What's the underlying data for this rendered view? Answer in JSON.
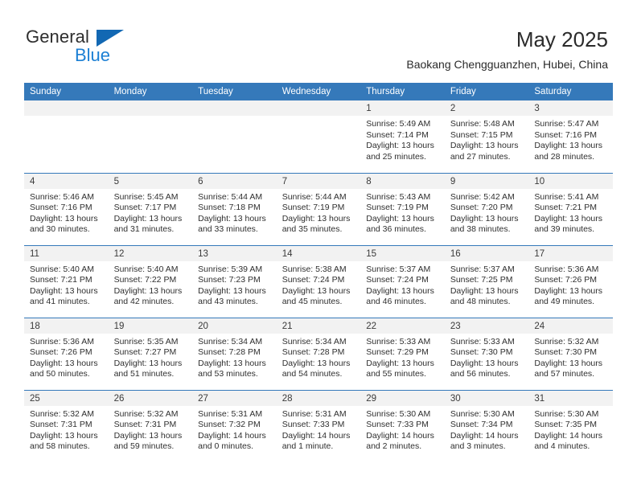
{
  "brand": {
    "name_part1": "General",
    "name_part2": "Blue",
    "triangle_color": "#1268b3",
    "blue_color": "#1b7fd4"
  },
  "header": {
    "title": "May 2025",
    "subtitle": "Baokang Chengguanzhen, Hubei, China"
  },
  "theme": {
    "header_bg": "#3579ba",
    "daynum_band_bg": "#f2f2f2",
    "grid_line": "#3579ba"
  },
  "weekday_headers": [
    "Sunday",
    "Monday",
    "Tuesday",
    "Wednesday",
    "Thursday",
    "Friday",
    "Saturday"
  ],
  "weeks": [
    [
      {
        "day": "",
        "empty": true,
        "sunrise": "",
        "sunset": "",
        "daylight1": "",
        "daylight2": ""
      },
      {
        "day": "",
        "empty": true,
        "sunrise": "",
        "sunset": "",
        "daylight1": "",
        "daylight2": ""
      },
      {
        "day": "",
        "empty": true,
        "sunrise": "",
        "sunset": "",
        "daylight1": "",
        "daylight2": ""
      },
      {
        "day": "",
        "empty": true,
        "sunrise": "",
        "sunset": "",
        "daylight1": "",
        "daylight2": ""
      },
      {
        "day": "1",
        "empty": false,
        "sunrise": "Sunrise: 5:49 AM",
        "sunset": "Sunset: 7:14 PM",
        "daylight1": "Daylight: 13 hours",
        "daylight2": "and 25 minutes."
      },
      {
        "day": "2",
        "empty": false,
        "sunrise": "Sunrise: 5:48 AM",
        "sunset": "Sunset: 7:15 PM",
        "daylight1": "Daylight: 13 hours",
        "daylight2": "and 27 minutes."
      },
      {
        "day": "3",
        "empty": false,
        "sunrise": "Sunrise: 5:47 AM",
        "sunset": "Sunset: 7:16 PM",
        "daylight1": "Daylight: 13 hours",
        "daylight2": "and 28 minutes."
      }
    ],
    [
      {
        "day": "4",
        "empty": false,
        "sunrise": "Sunrise: 5:46 AM",
        "sunset": "Sunset: 7:16 PM",
        "daylight1": "Daylight: 13 hours",
        "daylight2": "and 30 minutes."
      },
      {
        "day": "5",
        "empty": false,
        "sunrise": "Sunrise: 5:45 AM",
        "sunset": "Sunset: 7:17 PM",
        "daylight1": "Daylight: 13 hours",
        "daylight2": "and 31 minutes."
      },
      {
        "day": "6",
        "empty": false,
        "sunrise": "Sunrise: 5:44 AM",
        "sunset": "Sunset: 7:18 PM",
        "daylight1": "Daylight: 13 hours",
        "daylight2": "and 33 minutes."
      },
      {
        "day": "7",
        "empty": false,
        "sunrise": "Sunrise: 5:44 AM",
        "sunset": "Sunset: 7:19 PM",
        "daylight1": "Daylight: 13 hours",
        "daylight2": "and 35 minutes."
      },
      {
        "day": "8",
        "empty": false,
        "sunrise": "Sunrise: 5:43 AM",
        "sunset": "Sunset: 7:19 PM",
        "daylight1": "Daylight: 13 hours",
        "daylight2": "and 36 minutes."
      },
      {
        "day": "9",
        "empty": false,
        "sunrise": "Sunrise: 5:42 AM",
        "sunset": "Sunset: 7:20 PM",
        "daylight1": "Daylight: 13 hours",
        "daylight2": "and 38 minutes."
      },
      {
        "day": "10",
        "empty": false,
        "sunrise": "Sunrise: 5:41 AM",
        "sunset": "Sunset: 7:21 PM",
        "daylight1": "Daylight: 13 hours",
        "daylight2": "and 39 minutes."
      }
    ],
    [
      {
        "day": "11",
        "empty": false,
        "sunrise": "Sunrise: 5:40 AM",
        "sunset": "Sunset: 7:21 PM",
        "daylight1": "Daylight: 13 hours",
        "daylight2": "and 41 minutes."
      },
      {
        "day": "12",
        "empty": false,
        "sunrise": "Sunrise: 5:40 AM",
        "sunset": "Sunset: 7:22 PM",
        "daylight1": "Daylight: 13 hours",
        "daylight2": "and 42 minutes."
      },
      {
        "day": "13",
        "empty": false,
        "sunrise": "Sunrise: 5:39 AM",
        "sunset": "Sunset: 7:23 PM",
        "daylight1": "Daylight: 13 hours",
        "daylight2": "and 43 minutes."
      },
      {
        "day": "14",
        "empty": false,
        "sunrise": "Sunrise: 5:38 AM",
        "sunset": "Sunset: 7:24 PM",
        "daylight1": "Daylight: 13 hours",
        "daylight2": "and 45 minutes."
      },
      {
        "day": "15",
        "empty": false,
        "sunrise": "Sunrise: 5:37 AM",
        "sunset": "Sunset: 7:24 PM",
        "daylight1": "Daylight: 13 hours",
        "daylight2": "and 46 minutes."
      },
      {
        "day": "16",
        "empty": false,
        "sunrise": "Sunrise: 5:37 AM",
        "sunset": "Sunset: 7:25 PM",
        "daylight1": "Daylight: 13 hours",
        "daylight2": "and 48 minutes."
      },
      {
        "day": "17",
        "empty": false,
        "sunrise": "Sunrise: 5:36 AM",
        "sunset": "Sunset: 7:26 PM",
        "daylight1": "Daylight: 13 hours",
        "daylight2": "and 49 minutes."
      }
    ],
    [
      {
        "day": "18",
        "empty": false,
        "sunrise": "Sunrise: 5:36 AM",
        "sunset": "Sunset: 7:26 PM",
        "daylight1": "Daylight: 13 hours",
        "daylight2": "and 50 minutes."
      },
      {
        "day": "19",
        "empty": false,
        "sunrise": "Sunrise: 5:35 AM",
        "sunset": "Sunset: 7:27 PM",
        "daylight1": "Daylight: 13 hours",
        "daylight2": "and 51 minutes."
      },
      {
        "day": "20",
        "empty": false,
        "sunrise": "Sunrise: 5:34 AM",
        "sunset": "Sunset: 7:28 PM",
        "daylight1": "Daylight: 13 hours",
        "daylight2": "and 53 minutes."
      },
      {
        "day": "21",
        "empty": false,
        "sunrise": "Sunrise: 5:34 AM",
        "sunset": "Sunset: 7:28 PM",
        "daylight1": "Daylight: 13 hours",
        "daylight2": "and 54 minutes."
      },
      {
        "day": "22",
        "empty": false,
        "sunrise": "Sunrise: 5:33 AM",
        "sunset": "Sunset: 7:29 PM",
        "daylight1": "Daylight: 13 hours",
        "daylight2": "and 55 minutes."
      },
      {
        "day": "23",
        "empty": false,
        "sunrise": "Sunrise: 5:33 AM",
        "sunset": "Sunset: 7:30 PM",
        "daylight1": "Daylight: 13 hours",
        "daylight2": "and 56 minutes."
      },
      {
        "day": "24",
        "empty": false,
        "sunrise": "Sunrise: 5:32 AM",
        "sunset": "Sunset: 7:30 PM",
        "daylight1": "Daylight: 13 hours",
        "daylight2": "and 57 minutes."
      }
    ],
    [
      {
        "day": "25",
        "empty": false,
        "sunrise": "Sunrise: 5:32 AM",
        "sunset": "Sunset: 7:31 PM",
        "daylight1": "Daylight: 13 hours",
        "daylight2": "and 58 minutes."
      },
      {
        "day": "26",
        "empty": false,
        "sunrise": "Sunrise: 5:32 AM",
        "sunset": "Sunset: 7:31 PM",
        "daylight1": "Daylight: 13 hours",
        "daylight2": "and 59 minutes."
      },
      {
        "day": "27",
        "empty": false,
        "sunrise": "Sunrise: 5:31 AM",
        "sunset": "Sunset: 7:32 PM",
        "daylight1": "Daylight: 14 hours",
        "daylight2": "and 0 minutes."
      },
      {
        "day": "28",
        "empty": false,
        "sunrise": "Sunrise: 5:31 AM",
        "sunset": "Sunset: 7:33 PM",
        "daylight1": "Daylight: 14 hours",
        "daylight2": "and 1 minute."
      },
      {
        "day": "29",
        "empty": false,
        "sunrise": "Sunrise: 5:30 AM",
        "sunset": "Sunset: 7:33 PM",
        "daylight1": "Daylight: 14 hours",
        "daylight2": "and 2 minutes."
      },
      {
        "day": "30",
        "empty": false,
        "sunrise": "Sunrise: 5:30 AM",
        "sunset": "Sunset: 7:34 PM",
        "daylight1": "Daylight: 14 hours",
        "daylight2": "and 3 minutes."
      },
      {
        "day": "31",
        "empty": false,
        "sunrise": "Sunrise: 5:30 AM",
        "sunset": "Sunset: 7:35 PM",
        "daylight1": "Daylight: 14 hours",
        "daylight2": "and 4 minutes."
      }
    ]
  ]
}
